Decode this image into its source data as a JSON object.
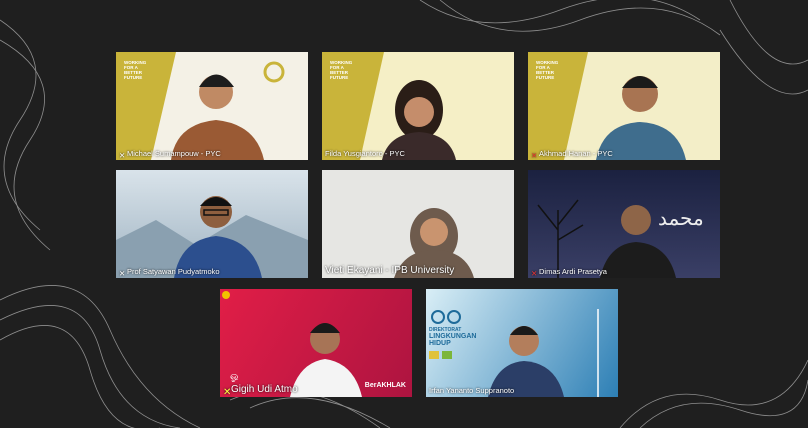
{
  "banner": {
    "line1": "WORKING",
    "line2": "FOR A",
    "line3": "BETTER",
    "line4": "FUTURE"
  },
  "tiles": [
    {
      "name": "Michael Sumampouw - PYC",
      "muted": true
    },
    {
      "name": "Filda Yusgiantoro - PYC",
      "muted": false
    },
    {
      "name": "Akhmad Hanan - PYC",
      "muted": true
    },
    {
      "name": "Prof Satyawan Pudyatmoko",
      "muted": true
    },
    {
      "name": "Vieti Ekayani - IPB University",
      "muted": false
    },
    {
      "name": "Dimas Ardi Prasetya",
      "muted": true
    },
    {
      "name": "Gigih Udi Atmo",
      "muted": true
    },
    {
      "name": "Irfan Yananto Suppranoto",
      "muted": false
    }
  ],
  "slides": {
    "klhk_title": "DIREKTORAT",
    "klhk_sub1": "LINGKUNGAN",
    "klhk_sub2": "HIDUP",
    "berakhlak": "BerAKHLAK"
  },
  "colors": {
    "yellow": "#c9b43a",
    "pink": "#d6214f",
    "blue": "#2d7fb5"
  }
}
